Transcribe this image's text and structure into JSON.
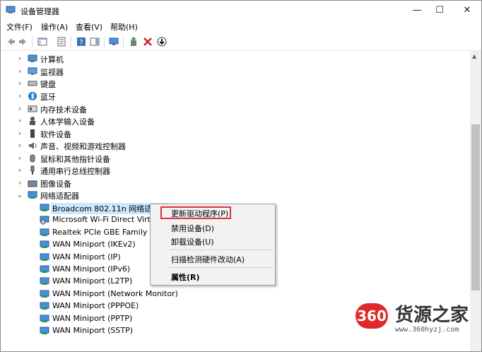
{
  "window": {
    "title": "设备管理器",
    "minimize_glyph": "—",
    "maximize_glyph": "☐",
    "close_glyph": "✕"
  },
  "menubar": [
    "文件(F)",
    "操作(A)",
    "查看(V)",
    "帮助(H)"
  ],
  "toolbar": [
    "back-icon",
    "forward-icon",
    "show-hide-console-tree-icon",
    "properties-icon",
    "help-icon",
    "action-pane-icon",
    "monitor-icon",
    "update-driver-icon",
    "uninstall-icon",
    "download-icon"
  ],
  "tree": {
    "categories": [
      {
        "label": "计算机",
        "icon": "computer-icon"
      },
      {
        "label": "监视器",
        "icon": "monitor-icon"
      },
      {
        "label": "键盘",
        "icon": "keyboard-icon"
      },
      {
        "label": "蓝牙",
        "icon": "bluetooth-icon"
      },
      {
        "label": "内存技术设备",
        "icon": "memory-icon"
      },
      {
        "label": "人体学输入设备",
        "icon": "hid-icon"
      },
      {
        "label": "软件设备",
        "icon": "software-device-icon"
      },
      {
        "label": "声音、视频和游戏控制器",
        "icon": "speaker-icon"
      },
      {
        "label": "鼠标和其他指针设备",
        "icon": "mouse-icon"
      },
      {
        "label": "通用串行总线控制器",
        "icon": "usb-icon"
      },
      {
        "label": "图像设备",
        "icon": "camera-icon"
      },
      {
        "label": "网络适配器",
        "icon": "network-adapter-icon",
        "expanded": true
      }
    ],
    "network_adapters": [
      "Broadcom 802.11n 网络适配器",
      "Microsoft Wi-Fi Direct Virtu",
      "Realtek PCIe GBE Family Co",
      "WAN Miniport (IKEv2)",
      "WAN Miniport (IP)",
      "WAN Miniport (IPv6)",
      "WAN Miniport (L2TP)",
      "WAN Miniport (Network Monitor)",
      "WAN Miniport (PPPOE)",
      "WAN Miniport (PPTP)",
      "WAN Miniport (SSTP)"
    ]
  },
  "context_menu": {
    "update_driver": "更新驱动程序(P)",
    "disable_device": "禁用设备(D)",
    "uninstall_device": "卸载设备(U)",
    "scan_hardware": "扫描检测硬件改动(A)",
    "properties": "属性(R)"
  },
  "watermark": {
    "badge": "360",
    "text": "货源之家",
    "url": "www.360hyzj.com"
  },
  "colors": {
    "highlight_border": "#d9333f",
    "selection": "#cce8ff",
    "badge": "#e2272a",
    "accent_blue": "#1e78d7"
  }
}
